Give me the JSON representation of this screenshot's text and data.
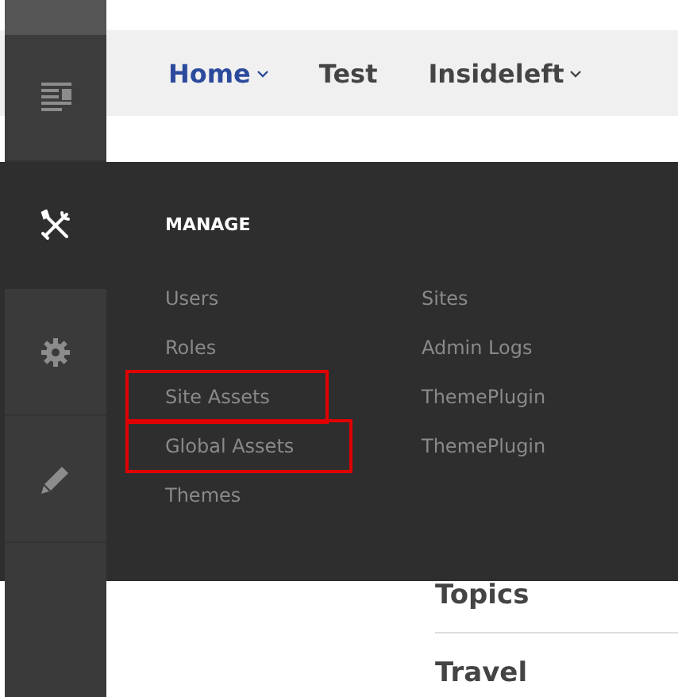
{
  "sidebar": {
    "items": [
      {
        "kind": "list",
        "selected": false
      },
      {
        "kind": "tools",
        "selected": true
      },
      {
        "kind": "gear",
        "selected": false
      },
      {
        "kind": "pencil",
        "selected": false
      }
    ]
  },
  "nav": {
    "items": [
      {
        "label": "Home",
        "selected": true,
        "dropdown": true
      },
      {
        "label": "Test",
        "selected": false,
        "dropdown": false
      },
      {
        "label": "Insideleft",
        "selected": false,
        "dropdown": true
      }
    ]
  },
  "flyout": {
    "title": "MANAGE",
    "columns": [
      [
        {
          "label": "Users",
          "highlighted": false
        },
        {
          "label": "Roles",
          "highlighted": false
        },
        {
          "label": "Site Assets",
          "highlighted": true
        },
        {
          "label": "Global Assets",
          "highlighted": true
        },
        {
          "label": "Themes",
          "highlighted": false
        }
      ],
      [
        {
          "label": "Sites",
          "highlighted": false
        },
        {
          "label": "Admin Logs",
          "highlighted": false
        },
        {
          "label": "ThemePlugin",
          "highlighted": false
        },
        {
          "label": "ThemePlugin",
          "highlighted": false
        }
      ]
    ]
  },
  "content": {
    "headings": [
      "Topics",
      "Travel"
    ]
  }
}
